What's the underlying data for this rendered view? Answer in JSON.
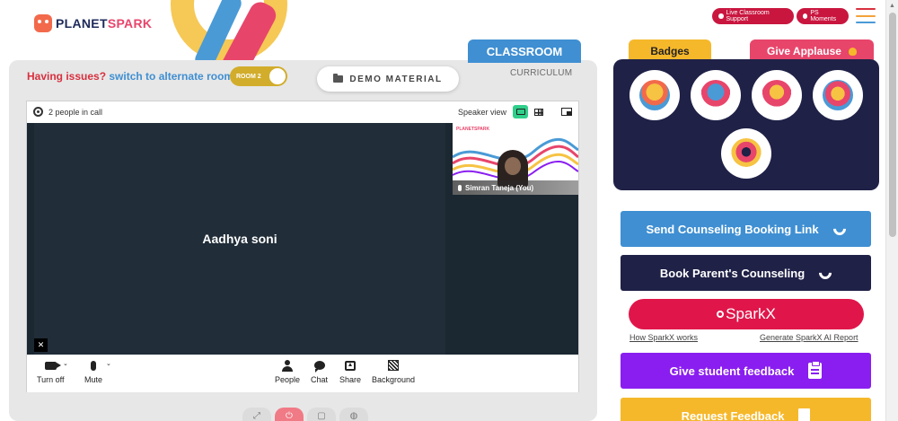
{
  "brand": {
    "logo_text_a": "PLANET",
    "logo_text_b": "SPARK"
  },
  "header": {
    "live_support": "Live Classroom Support",
    "ps_moments": "PS Moments"
  },
  "tabs": {
    "classroom": "CLASSROOM",
    "curriculum": "CURRICULUM",
    "badges": "Badges",
    "give_applause": "Give Applause"
  },
  "issues": {
    "prefix": "Having issues?",
    "link": "switch to alternate room",
    "toggle_label": "ROOM 2"
  },
  "demo_material": "DEMO MATERIAL",
  "call": {
    "people_count": "2 people in call",
    "speaker_view": "Speaker view",
    "main_participant": "Aadhya soni",
    "self_name": "Simran Taneja (You)",
    "mini_logo": "PLANETSPARK",
    "toolbar": {
      "turn_off": "Turn off",
      "mute": "Mute",
      "people": "People",
      "chat": "Chat",
      "share": "Share",
      "background": "Background"
    }
  },
  "actions": {
    "send_counseling": "Send Counseling Booking Link",
    "book_parent": "Book Parent's Counseling",
    "sparkx": "SparkX",
    "how_sparkx": "How SparkX works",
    "generate_report": "Generate SparkX AI Report",
    "give_feedback": "Give student feedback",
    "request_feedback": "Request Feedback"
  },
  "colors": {
    "accent_blue": "#3f8fd2",
    "navy": "#1f2147",
    "pink": "#e0164a",
    "purple": "#8a1ef0",
    "amber": "#f6b82b"
  },
  "icons": [
    "gear-icon",
    "camera-icon",
    "mic-icon",
    "people-icon",
    "chat-icon",
    "share-icon",
    "background-icon",
    "phone-icon",
    "clipboard-icon",
    "document-icon",
    "folder-icon"
  ]
}
